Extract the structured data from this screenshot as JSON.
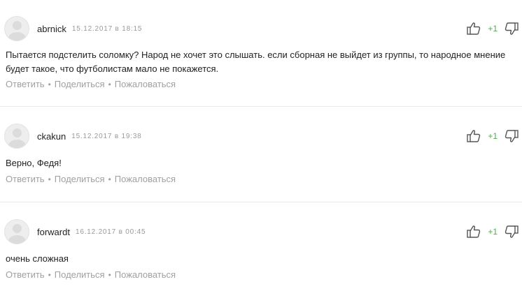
{
  "comments": [
    {
      "username": "abrnick",
      "date": "15.12.2017 в 18:15",
      "score": "+1",
      "text": "Пытается подстелить соломку? Народ не хочет это слышать. если сборная не выйдет из группы, то народное мнение будет такое, что футболистам мало не покажется.",
      "reply_label": "Ответить",
      "share_label": "Поделиться",
      "report_label": "Пожаловаться",
      "separator": "•"
    },
    {
      "username": "ckakun",
      "date": "15.12.2017 в 19:38",
      "score": "+1",
      "text": "Верно, Федя!",
      "reply_label": "Ответить",
      "share_label": "Поделиться",
      "report_label": "Пожаловаться",
      "separator": "•"
    },
    {
      "username": "forwardt",
      "date": "16.12.2017 в 00:45",
      "score": "+1",
      "text": "очень сложная",
      "reply_label": "Ответить",
      "share_label": "Поделиться",
      "report_label": "Пожаловаться",
      "separator": "•"
    }
  ],
  "icons": {
    "avatar": "default-user-avatar",
    "like": "thumbs-up-icon",
    "dislike": "thumbs-down-icon"
  },
  "colors": {
    "score": "#4cae4c",
    "muted": "#a0a0a0",
    "date": "#9a9a9a",
    "text": "#222222"
  }
}
